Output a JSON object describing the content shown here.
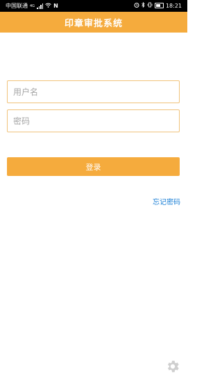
{
  "status_bar": {
    "carrier": "中国联通",
    "network": "4G",
    "nfc": "N",
    "time": "18:21"
  },
  "header": {
    "title": "印章审批系统"
  },
  "form": {
    "username_placeholder": "用户名",
    "password_placeholder": "密码"
  },
  "actions": {
    "login_label": "登录",
    "forgot_password_label": "忘记密码"
  },
  "icons": {
    "settings": "gear-icon"
  },
  "colors": {
    "accent": "#f5ab3d",
    "link": "#1a7fd6",
    "field_border": "#f0c27a"
  }
}
